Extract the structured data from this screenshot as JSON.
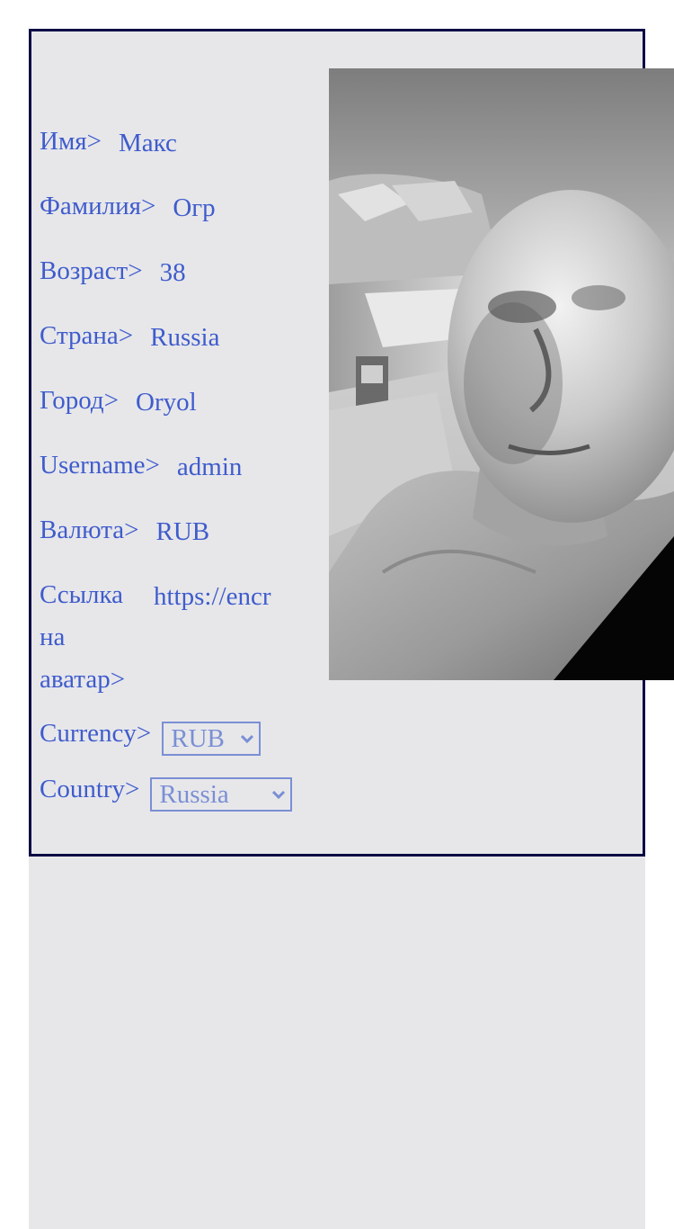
{
  "profile": {
    "first_name": {
      "label": "Имя>",
      "value": "Макс"
    },
    "last_name": {
      "label": "Фамилия>",
      "value": "Огр"
    },
    "age": {
      "label": "Возраст>",
      "value": "38"
    },
    "country": {
      "label": "Страна>",
      "value": "Russia"
    },
    "city": {
      "label": "Город>",
      "value": "Oryol"
    },
    "username": {
      "label": "Username>",
      "value": "admin"
    },
    "currency": {
      "label": "Валюта>",
      "value": "RUB"
    },
    "avatar_link": {
      "label": "Ссылка на аватар>",
      "value": "https://encr"
    }
  },
  "settings": {
    "currency": {
      "label": "Currency>",
      "selected": "RUB"
    },
    "country": {
      "label": "Country>",
      "selected": "Russia"
    }
  },
  "colors": {
    "text": "#3f5ccc",
    "select": "#7a8fd4",
    "card_border": "#0d0b45",
    "panel_bg": "#e7e7ea"
  },
  "icons": {
    "select_arrow": "chevron-down-icon"
  }
}
